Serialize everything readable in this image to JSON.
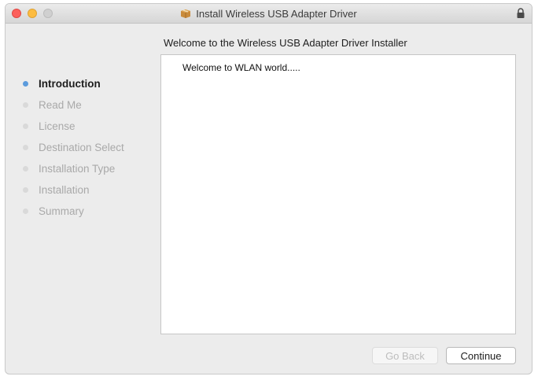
{
  "window": {
    "title": "Install Wireless USB Adapter Driver",
    "title_icon": "package-icon",
    "lock_icon": "lock-icon"
  },
  "header": {
    "text": "Welcome to the Wireless USB Adapter Driver Installer"
  },
  "steps": [
    {
      "label": "Introduction",
      "active": true
    },
    {
      "label": "Read Me",
      "active": false
    },
    {
      "label": "License",
      "active": false
    },
    {
      "label": "Destination Select",
      "active": false
    },
    {
      "label": "Installation Type",
      "active": false
    },
    {
      "label": "Installation",
      "active": false
    },
    {
      "label": "Summary",
      "active": false
    }
  ],
  "content": {
    "text": "Welcome to WLAN world....."
  },
  "buttons": {
    "back_label": "Go Back",
    "back_enabled": false,
    "continue_label": "Continue"
  },
  "colors": {
    "active_step_dot": "#5b9bdc",
    "close": "#fc605c",
    "minimize": "#fdbc40",
    "maximize": "#d0d0d0"
  }
}
